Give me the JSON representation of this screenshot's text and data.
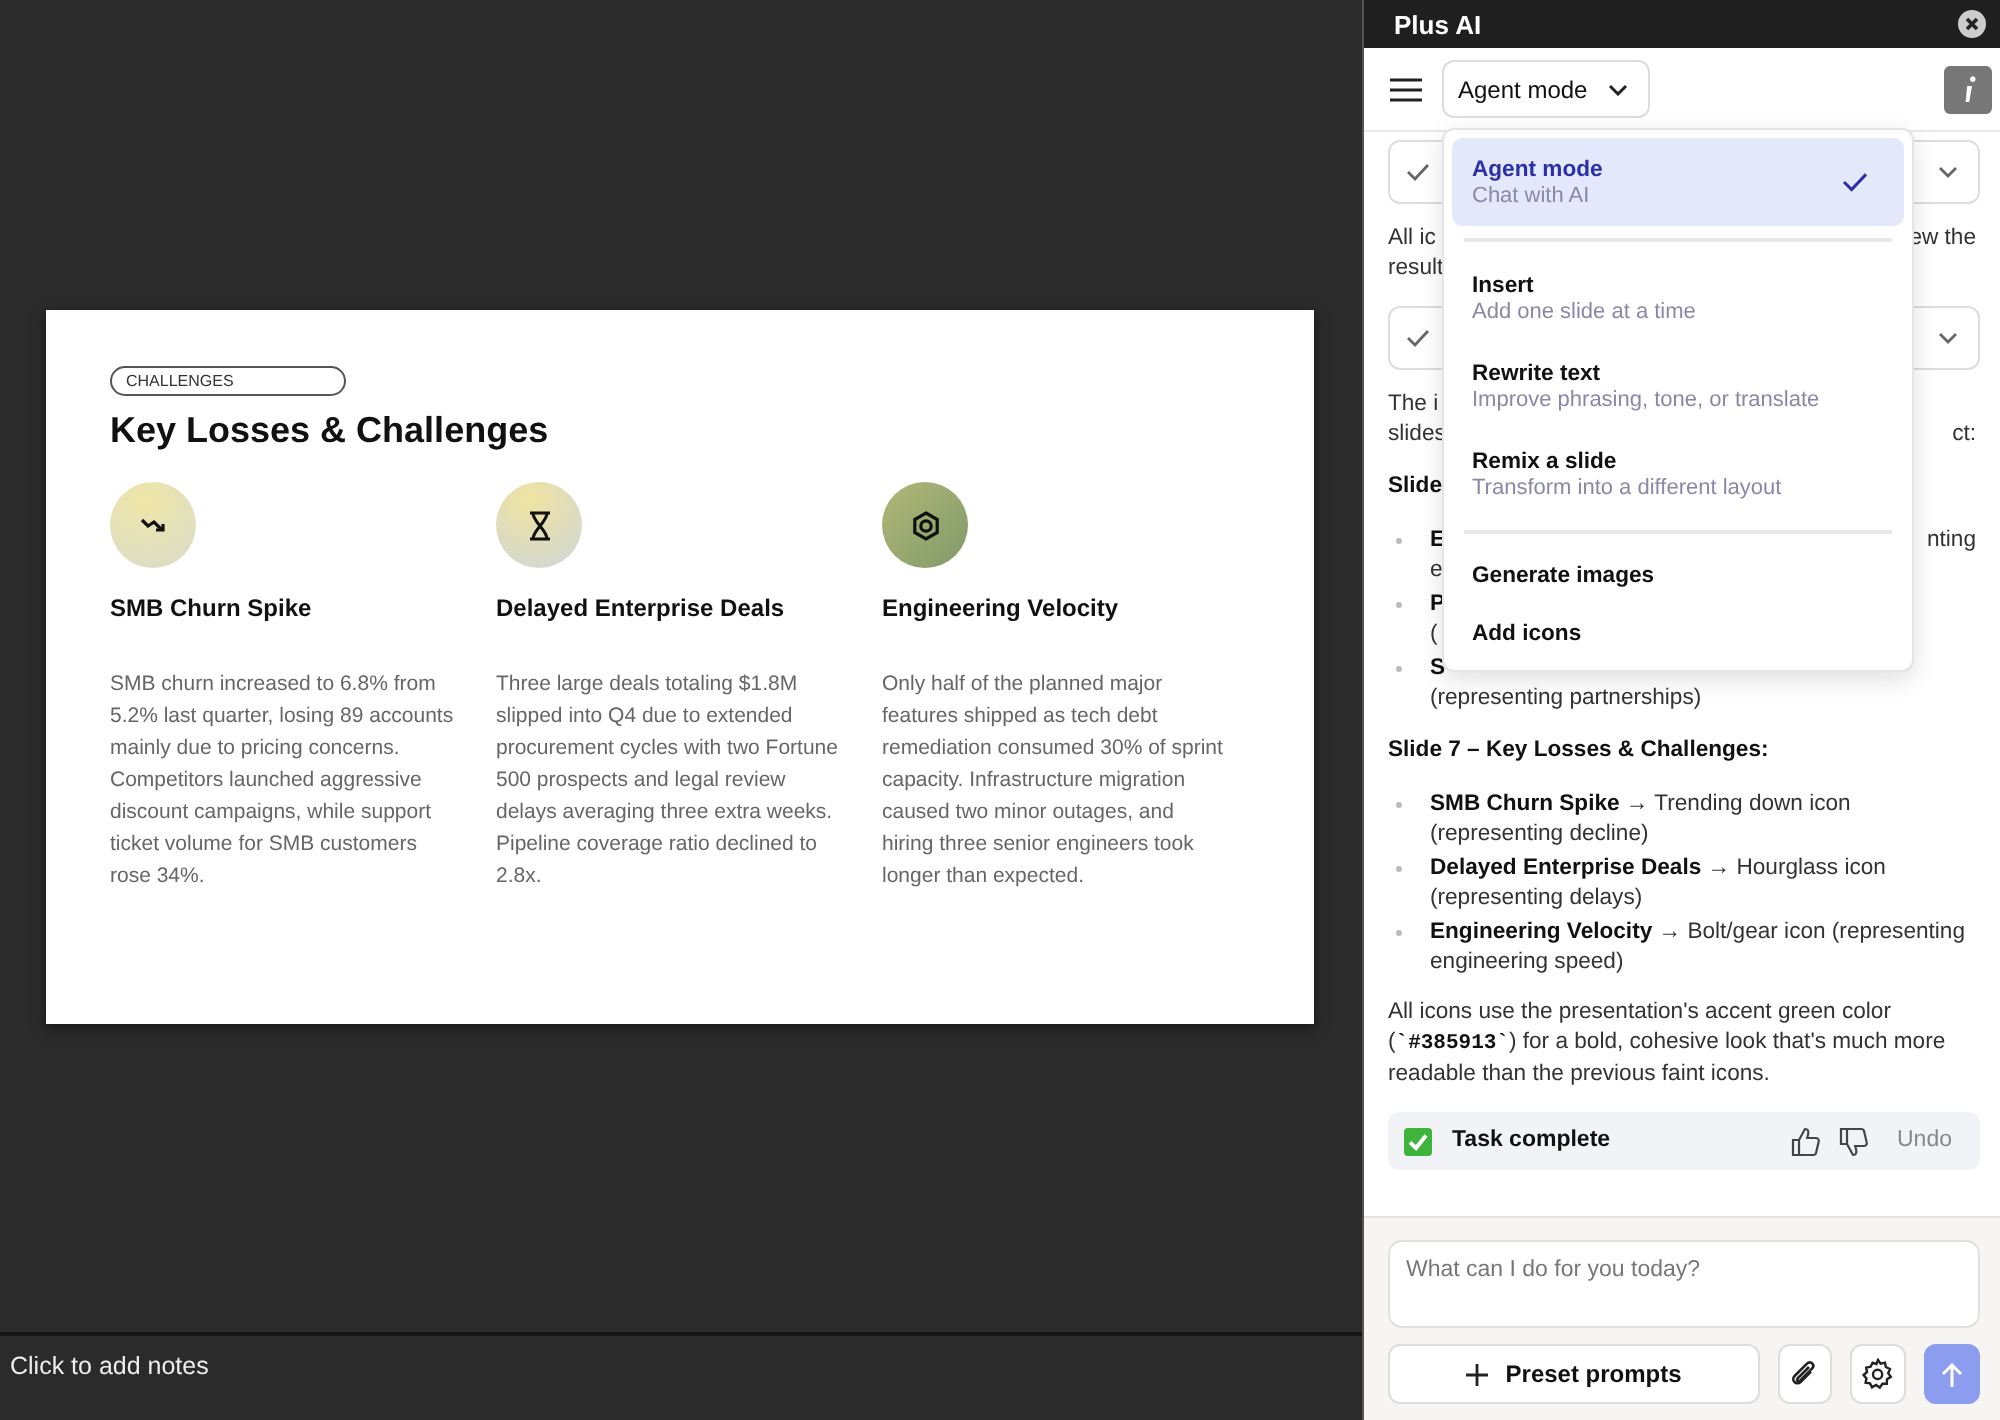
{
  "slide": {
    "tag": "CHALLENGES",
    "title": "Key Losses & Challenges",
    "columns": [
      {
        "heading": "SMB Churn Spike",
        "body": "SMB churn increased to 6.8% from 5.2% last quarter, losing 89 accounts mainly due to pricing concerns. Competitors launched aggressive discount campaigns, while support ticket volume for SMB customers rose 34%."
      },
      {
        "heading": "Delayed Enterprise Deals",
        "body": "Three large deals totaling $1.8M slipped into Q4 due to extended procurement cycles with two Fortune 500 prospects and legal review delays averaging three extra weeks. Pipeline coverage ratio declined to 2.8x."
      },
      {
        "heading": "Engineering Velocity",
        "body": "Only half of the planned major features shipped as tech debt remediation consumed 30% of sprint capacity. Infrastructure migration caused two minor outages, and hiring three senior engineers took longer than expected."
      }
    ]
  },
  "notes": {
    "placeholder": "Click to add notes"
  },
  "panel": {
    "title": "Plus AI",
    "mode": "Agent mode",
    "menu": [
      [
        {
          "label": "Agent mode",
          "subtitle": "Chat with AI",
          "selected": true
        }
      ],
      [
        {
          "label": "Insert",
          "subtitle": "Add one slide at a time",
          "selected": false
        },
        {
          "label": "Rewrite text",
          "subtitle": "Improve phrasing, tone, or translate",
          "selected": false
        },
        {
          "label": "Remix a slide",
          "subtitle": "Transform into a different layout",
          "selected": false
        }
      ],
      [
        {
          "label": "Generate images",
          "selected": false
        },
        {
          "label": "Add icons",
          "selected": false
        }
      ]
    ],
    "chat": [
      {
        "kind": "step"
      },
      {
        "kind": "line",
        "left": "All ic",
        "right": "ew the"
      },
      {
        "kind": "line",
        "left": "result"
      },
      {
        "kind": "step"
      },
      {
        "kind": "line",
        "left": "The i"
      },
      {
        "kind": "line",
        "left": "slides",
        "right": "ct:"
      },
      {
        "kind": "heading",
        "left": "Slide"
      },
      {
        "kind": "bullet",
        "left": "E",
        "right": "nting"
      },
      {
        "kind": "continuation",
        "left": "e"
      },
      {
        "kind": "bullet",
        "left": "P"
      },
      {
        "kind": "continuation",
        "left": "("
      },
      {
        "kind": "bullet",
        "left": "S"
      },
      {
        "kind": "continuation",
        "left": "(representing partnerships)"
      },
      {
        "kind": "heading",
        "left": "Slide 7 – Key Losses & Challenges:"
      },
      {
        "kind": "item",
        "text": "**SMB Churn Spike** → Trending down icon (representing decline)"
      },
      {
        "kind": "item",
        "text": "**Delayed Enterprise Deals** → Hourglass icon (representing delays)"
      },
      {
        "kind": "item",
        "text": "**Engineering Velocity** → Bolt/gear icon (representing engineering speed)"
      },
      {
        "kind": "paragraph",
        "text": "All icons use the presentation's accent green color (**`#385913`**) for a bold, cohesive look that's much more readable than the previous faint icons."
      },
      {
        "kind": "status",
        "text": "Task complete",
        "action": "Undo"
      }
    ],
    "input": {
      "placeholder": "What can I do for you today?"
    },
    "preset": "Preset prompts"
  }
}
